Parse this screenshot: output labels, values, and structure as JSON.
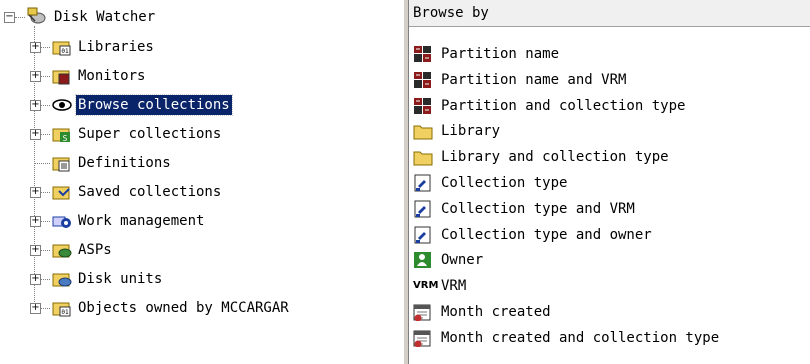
{
  "tree": {
    "root_label": "Disk Watcher",
    "items": [
      {
        "label": "Libraries"
      },
      {
        "label": "Monitors"
      },
      {
        "label": "Browse collections"
      },
      {
        "label": "Super collections"
      },
      {
        "label": "Definitions"
      },
      {
        "label": "Saved collections"
      },
      {
        "label": "Work management"
      },
      {
        "label": "ASPs"
      },
      {
        "label": "Disk units"
      },
      {
        "label": "Objects owned by MCCARGAR"
      }
    ]
  },
  "pane": {
    "header": "Browse by",
    "items": [
      {
        "label": "Partition name",
        "icon": "partition-icon"
      },
      {
        "label": "Partition name and VRM",
        "icon": "partition-icon"
      },
      {
        "label": "Partition and collection type",
        "icon": "partition-icon"
      },
      {
        "label": "Library",
        "icon": "folder-icon"
      },
      {
        "label": "Library and collection type",
        "icon": "folder-icon"
      },
      {
        "label": "Collection type",
        "icon": "collection-type-icon"
      },
      {
        "label": "Collection type and VRM",
        "icon": "collection-type-icon"
      },
      {
        "label": "Collection type and owner",
        "icon": "collection-type-icon"
      },
      {
        "label": "Owner",
        "icon": "owner-icon"
      },
      {
        "label": "VRM",
        "icon": "vrm-icon"
      },
      {
        "label": "Month created",
        "icon": "calendar-icon"
      },
      {
        "label": "Month created and collection type",
        "icon": "calendar-icon"
      }
    ],
    "vrm_icon_text": "VRM"
  },
  "colors": {
    "selection": "#0a246a",
    "folder": "#f0d060",
    "partition": "#8b1a1a",
    "owner": "#2e8b2e"
  }
}
